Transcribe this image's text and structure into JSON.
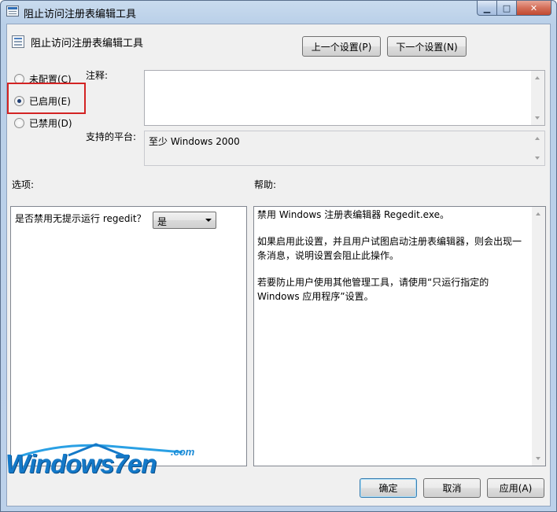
{
  "window": {
    "title": "阻止访问注册表编辑工具",
    "caption_min": "▁",
    "caption_max": "□",
    "caption_close": "✕"
  },
  "policy": {
    "name": "阻止访问注册表编辑工具",
    "prev_button": "上一个设置(P)",
    "next_button": "下一个设置(N)"
  },
  "state": {
    "options": [
      {
        "label": "未配置(C)",
        "checked": false
      },
      {
        "label": "已启用(E)",
        "checked": true
      },
      {
        "label": "已禁用(D)",
        "checked": false
      }
    ]
  },
  "comment": {
    "label": "注释:",
    "value": ""
  },
  "platform": {
    "label": "支持的平台:",
    "value": "至少 Windows 2000"
  },
  "options_section": {
    "label": "选项:",
    "question": "是否禁用无提示运行 regedit？",
    "select_value": "是"
  },
  "help_section": {
    "label": "帮助:",
    "paragraphs": [
      "禁用 Windows 注册表编辑器 Regedit.exe。",
      "如果启用此设置，并且用户试图启动注册表编辑器，则会出现一条消息，说明设置会阻止此操作。",
      "若要防止用户使用其他管理工具，请使用“只运行指定的 Windows 应用程序”设置。"
    ]
  },
  "footer": {
    "ok": "确定",
    "cancel": "取消",
    "apply": "应用(A)"
  },
  "watermark": {
    "text": "Windows7en",
    "domain": ".com"
  },
  "colors": {
    "highlight_border": "#d32323",
    "logo_blue": "#1479c8"
  }
}
